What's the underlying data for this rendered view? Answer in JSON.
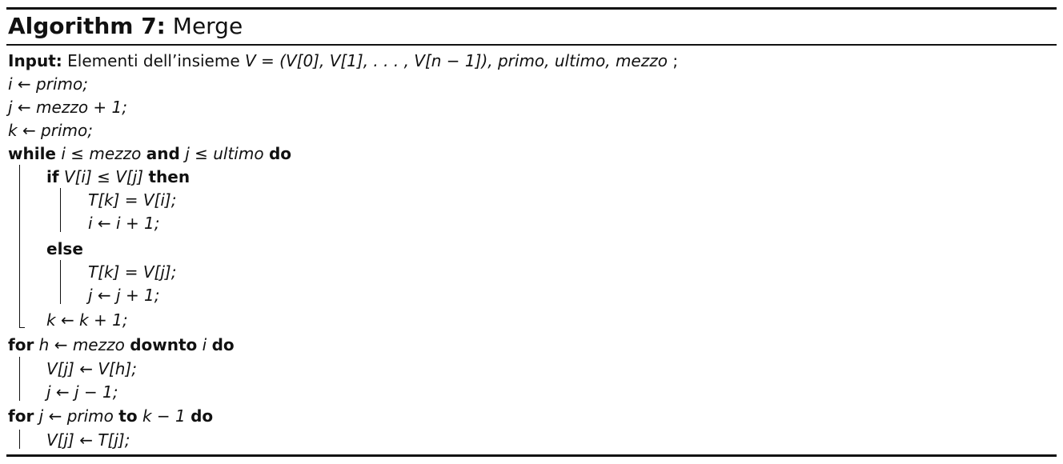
{
  "caption": {
    "prefix": "Algorithm 7:",
    "title": "Merge"
  },
  "keywords": {
    "input": "Input:",
    "while": "while",
    "and": "and",
    "do": "do",
    "if": "if",
    "then": "then",
    "else": "else",
    "for": "for",
    "downto": "downto",
    "to": "to"
  },
  "lines": {
    "input_text": "Elementi dell’insieme",
    "input_set": "V = (V[0], V[1], . . . , V[n − 1]),",
    "input_params": "primo, ultimo, mezzo",
    "input_end": ";",
    "l1": "i ← primo;",
    "l2": "j ← mezzo + 1;",
    "l3": "k ← primo;",
    "while_i": "i ≤ mezzo",
    "while_j": "j ≤ ultimo",
    "if_cond": "V[i] ≤ V[j]",
    "if_s1": "T[k] = V[i];",
    "if_s2": "i ← i + 1;",
    "else_s1": "T[k] = V[j];",
    "else_s2": "j ← j + 1;",
    "k_inc": "k ← k + 1;",
    "for1_head": "h ← mezzo",
    "for1_tail": "i",
    "for1_s1": "V[j] ← V[h];",
    "for1_s2": "j ← j − 1;",
    "for2_head": "j ← primo",
    "for2_tail": "k − 1",
    "for2_s1": "V[j] ← T[j];"
  }
}
